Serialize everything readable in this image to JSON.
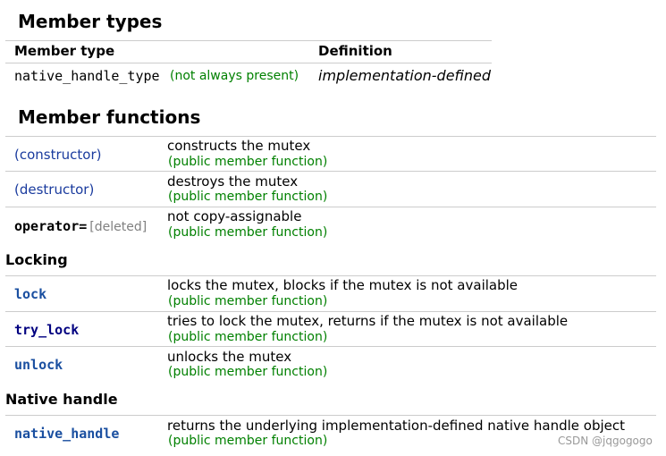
{
  "member_types": {
    "heading": "Member types",
    "col_type": "Member type",
    "col_def": "Definition",
    "row": {
      "name": "native_handle_type",
      "note": "(not always present)",
      "definition": "implementation-defined"
    }
  },
  "member_functions": {
    "heading": "Member functions",
    "rows": [
      {
        "name": "(constructor)",
        "desc": "constructs the mutex",
        "note": "(public member function)"
      },
      {
        "name": "(destructor)",
        "desc": "destroys the mutex",
        "note": "(public member function)"
      },
      {
        "name": "operator=",
        "suffix": "[deleted]",
        "desc": "not copy-assignable",
        "note": "(public member function)"
      }
    ]
  },
  "locking": {
    "heading": "Locking",
    "rows": [
      {
        "name": "lock",
        "desc": "locks the mutex, blocks if the mutex is not available",
        "note": "(public member function)"
      },
      {
        "name": "try_lock",
        "desc": "tries to lock the mutex, returns if the mutex is not available",
        "note": "(public member function)"
      },
      {
        "name": "unlock",
        "desc": "unlocks the mutex",
        "note": "(public member function)"
      }
    ]
  },
  "native": {
    "heading": "Native handle",
    "rows": [
      {
        "name": "native_handle",
        "desc": "returns the underlying implementation-defined native handle object",
        "note": "(public member function)"
      }
    ]
  },
  "watermark": "CSDN @jqgogogo"
}
